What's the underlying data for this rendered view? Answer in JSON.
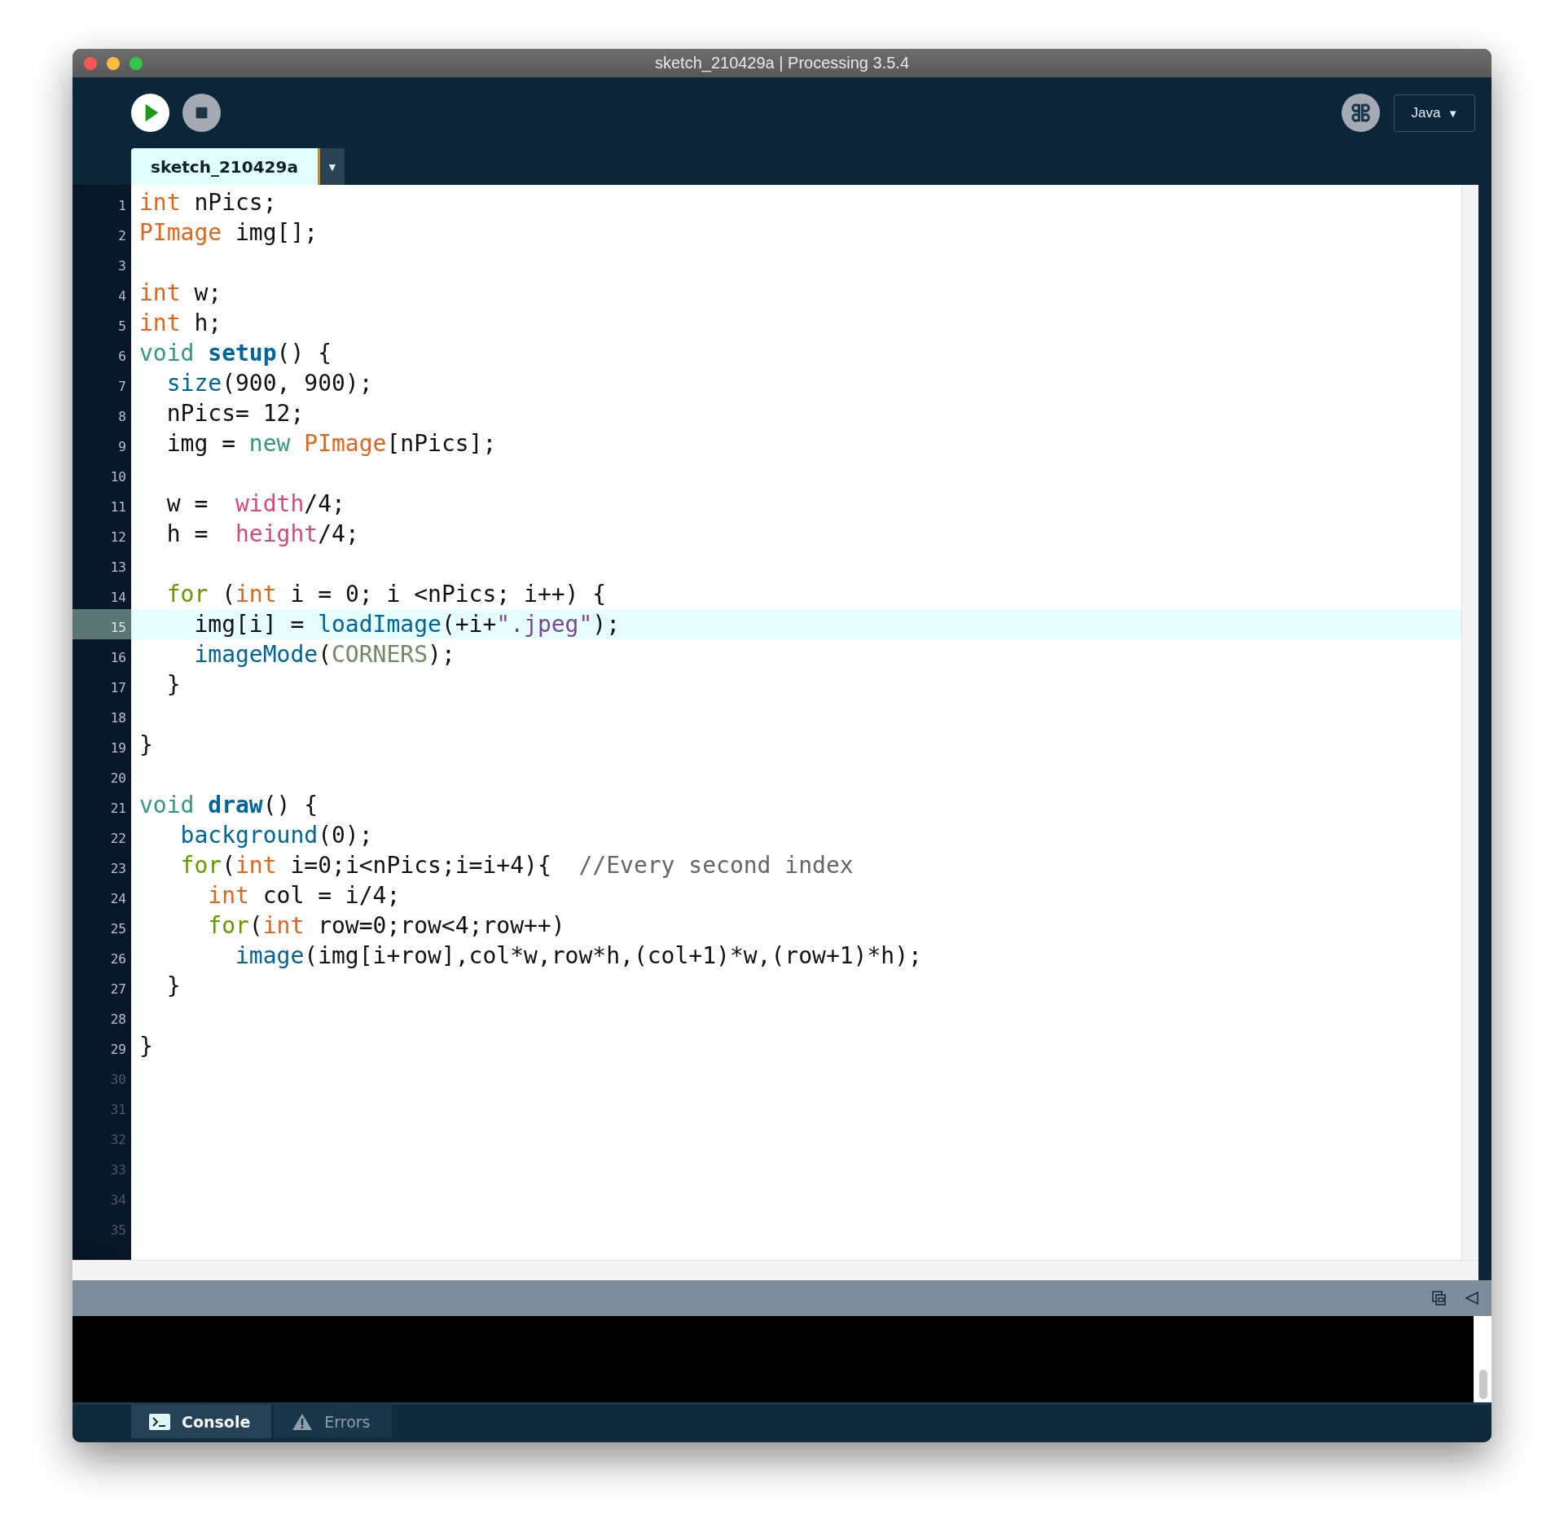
{
  "window": {
    "title": "sketch_210429a | Processing 3.5.4"
  },
  "toolbar": {
    "mode": {
      "label": "Java",
      "caret": "▼"
    }
  },
  "editor_tabs": [
    {
      "label": "sketch_210429a",
      "selected": true
    }
  ],
  "tab_menu": {
    "caret": "▼"
  },
  "lines": [
    {
      "number": "1",
      "current": false,
      "in_document": true,
      "tokens": [
        {
          "t": "int",
          "kind": "type"
        },
        {
          "t": " nPics;",
          "kind": "plain"
        }
      ]
    },
    {
      "number": "2",
      "current": false,
      "in_document": true,
      "tokens": [
        {
          "t": "PImage",
          "kind": "type"
        },
        {
          "t": " img[];",
          "kind": "plain"
        }
      ]
    },
    {
      "number": "3",
      "current": false,
      "in_document": true
    },
    {
      "number": "4",
      "current": false,
      "in_document": true,
      "tokens": [
        {
          "t": "int",
          "kind": "type"
        },
        {
          "t": " w;",
          "kind": "plain"
        }
      ]
    },
    {
      "number": "5",
      "current": false,
      "in_document": true,
      "tokens": [
        {
          "t": "int",
          "kind": "type"
        },
        {
          "t": " h;",
          "kind": "plain"
        }
      ]
    },
    {
      "number": "6",
      "current": false,
      "in_document": true,
      "tokens": [
        {
          "t": "void ",
          "kind": "keyword"
        },
        {
          "t": "setup",
          "kind": "method"
        },
        {
          "t": "() {",
          "kind": "plain"
        }
      ]
    },
    {
      "number": "7",
      "current": false,
      "in_document": true,
      "tokens": [
        {
          "t": "  size",
          "kind": "function"
        },
        {
          "t": "(900, 900);",
          "kind": "plain"
        }
      ]
    },
    {
      "number": "8",
      "current": false,
      "in_document": true,
      "tokens": [
        {
          "t": "  nPics= 12;",
          "kind": "plain"
        }
      ]
    },
    {
      "number": "9",
      "current": false,
      "in_document": true,
      "tokens": [
        {
          "t": "  img = ",
          "kind": "plain"
        },
        {
          "t": "new ",
          "kind": "keyword"
        },
        {
          "t": "PImage",
          "kind": "type"
        },
        {
          "t": "[nPics];",
          "kind": "plain"
        }
      ]
    },
    {
      "number": "10",
      "current": false,
      "in_document": true
    },
    {
      "number": "11",
      "current": false,
      "in_document": true,
      "tokens": [
        {
          "t": "  w =  ",
          "kind": "plain"
        },
        {
          "t": "width",
          "kind": "variable"
        },
        {
          "t": "/4;",
          "kind": "plain"
        }
      ]
    },
    {
      "number": "12",
      "current": false,
      "in_document": true,
      "tokens": [
        {
          "t": "  h =  ",
          "kind": "plain"
        },
        {
          "t": "height",
          "kind": "variable"
        },
        {
          "t": "/4;",
          "kind": "plain"
        }
      ]
    },
    {
      "number": "13",
      "current": false,
      "in_document": true
    },
    {
      "number": "14",
      "current": false,
      "in_document": true,
      "tokens": [
        {
          "t": "  for",
          "kind": "control"
        },
        {
          "t": " (",
          "kind": "plain"
        },
        {
          "t": "int",
          "kind": "type"
        },
        {
          "t": " i = 0; i <nPics; i++) {",
          "kind": "plain"
        }
      ]
    },
    {
      "number": "15",
      "current": true,
      "in_document": true,
      "tokens": [
        {
          "t": "    img[i] = ",
          "kind": "plain"
        },
        {
          "t": "loadImage",
          "kind": "function"
        },
        {
          "t": "(+i+",
          "kind": "plain"
        },
        {
          "t": "\".jpeg\"",
          "kind": "string"
        },
        {
          "t": ");",
          "kind": "plain"
        }
      ]
    },
    {
      "number": "16",
      "current": false,
      "in_document": true,
      "tokens": [
        {
          "t": "    imageMode",
          "kind": "function"
        },
        {
          "t": "(",
          "kind": "plain"
        },
        {
          "t": "CORNERS",
          "kind": "constant"
        },
        {
          "t": ");",
          "kind": "plain"
        }
      ]
    },
    {
      "number": "17",
      "current": false,
      "in_document": true,
      "tokens": [
        {
          "t": "  }",
          "kind": "plain"
        }
      ]
    },
    {
      "number": "18",
      "current": false,
      "in_document": true
    },
    {
      "number": "19",
      "current": false,
      "in_document": true,
      "tokens": [
        {
          "t": "}",
          "kind": "plain"
        }
      ]
    },
    {
      "number": "20",
      "current": false,
      "in_document": true
    },
    {
      "number": "21",
      "current": false,
      "in_document": true,
      "tokens": [
        {
          "t": "void ",
          "kind": "keyword"
        },
        {
          "t": "draw",
          "kind": "method"
        },
        {
          "t": "() {",
          "kind": "plain"
        }
      ]
    },
    {
      "number": "22",
      "current": false,
      "in_document": true,
      "tokens": [
        {
          "t": "   background",
          "kind": "function"
        },
        {
          "t": "(0);",
          "kind": "plain"
        }
      ]
    },
    {
      "number": "23",
      "current": false,
      "in_document": true,
      "tokens": [
        {
          "t": "   for",
          "kind": "control"
        },
        {
          "t": "(",
          "kind": "plain"
        },
        {
          "t": "int",
          "kind": "type"
        },
        {
          "t": " i=0;i<nPics;i=i+4){  ",
          "kind": "plain"
        },
        {
          "t": "//Every second index",
          "kind": "comment"
        }
      ]
    },
    {
      "number": "24",
      "current": false,
      "in_document": true,
      "tokens": [
        {
          "t": "     int",
          "kind": "type"
        },
        {
          "t": " col = i/4;",
          "kind": "plain"
        }
      ]
    },
    {
      "number": "25",
      "current": false,
      "in_document": true,
      "tokens": [
        {
          "t": "     for",
          "kind": "control"
        },
        {
          "t": "(",
          "kind": "plain"
        },
        {
          "t": "int",
          "kind": "type"
        },
        {
          "t": " row=0;row<4;row++)",
          "kind": "plain"
        }
      ]
    },
    {
      "number": "26",
      "current": false,
      "in_document": true,
      "tokens": [
        {
          "t": "       image",
          "kind": "function"
        },
        {
          "t": "(img[i+row],col*w,row*h,(col+1)*w,(row+1)*h);",
          "kind": "plain"
        }
      ]
    },
    {
      "number": "27",
      "current": false,
      "in_document": true,
      "tokens": [
        {
          "t": "  }",
          "kind": "plain"
        }
      ]
    },
    {
      "number": "28",
      "current": false,
      "in_document": true
    },
    {
      "number": "29",
      "current": false,
      "in_document": true,
      "tokens": [
        {
          "t": "}",
          "kind": "plain"
        }
      ]
    },
    {
      "number": "30",
      "current": false,
      "in_document": false
    },
    {
      "number": "31",
      "current": false,
      "in_document": false
    },
    {
      "number": "32",
      "current": false,
      "in_document": false
    },
    {
      "number": "33",
      "current": false,
      "in_document": false
    },
    {
      "number": "34",
      "current": false,
      "in_document": false
    },
    {
      "number": "35",
      "current": false,
      "in_document": false
    }
  ],
  "footer_tabs": [
    {
      "label": "Console",
      "kind": "console",
      "selected": true
    },
    {
      "label": "Errors",
      "kind": "errors",
      "selected": false
    }
  ]
}
